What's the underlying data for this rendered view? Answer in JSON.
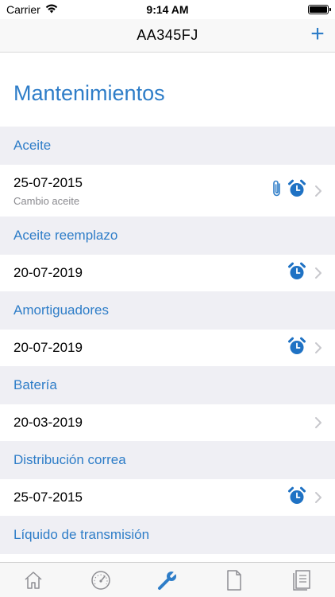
{
  "status_bar": {
    "carrier": "Carrier",
    "time": "9:14 AM"
  },
  "nav": {
    "title": "AA345FJ",
    "add_label": "+"
  },
  "page_title": "Mantenimientos",
  "sections": [
    {
      "header": "Aceite",
      "row": {
        "date": "25-07-2015",
        "subtitle": "Cambio aceite",
        "icons": [
          "paperclip-icon",
          "alarm-clock-icon"
        ]
      }
    },
    {
      "header": "Aceite reemplazo",
      "row": {
        "date": "20-07-2019",
        "icons": [
          "alarm-clock-icon"
        ]
      }
    },
    {
      "header": "Amortiguadores",
      "row": {
        "date": "20-07-2019",
        "icons": [
          "alarm-clock-icon"
        ]
      }
    },
    {
      "header": "Batería",
      "row": {
        "date": "20-03-2019",
        "icons": []
      }
    },
    {
      "header": "Distribución correa",
      "row": {
        "date": "25-07-2015",
        "icons": [
          "alarm-clock-icon"
        ]
      }
    },
    {
      "header": "Líquido de transmisión"
    }
  ],
  "tab_bar": {
    "tabs": [
      {
        "icon": "home-icon",
        "selected": false
      },
      {
        "icon": "speedometer-icon",
        "selected": false
      },
      {
        "icon": "wrench-icon",
        "selected": true
      },
      {
        "icon": "document-icon",
        "selected": false
      },
      {
        "icon": "notes-icon",
        "selected": false
      }
    ]
  },
  "colors": {
    "accent": "#2e7dc8",
    "section_bg": "#efeff4",
    "subtitle": "#8a8a8f",
    "tab_inactive": "#8e8e93"
  }
}
